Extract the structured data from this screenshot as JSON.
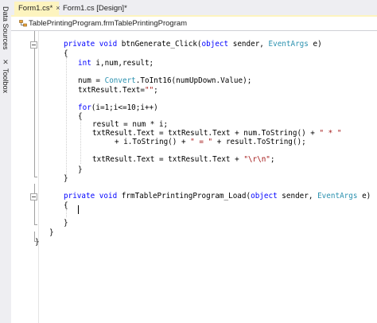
{
  "sidebar": {
    "data_sources_label": "Data Sources",
    "toolbox_label": "Toolbox"
  },
  "tabs": [
    {
      "label": "Form1.cs*",
      "active": true,
      "close": "×"
    },
    {
      "label": "Form1.cs [Design]*",
      "active": false
    }
  ],
  "navbar": {
    "path": "TablePrintingProgram.frmTablePrintingProgram"
  },
  "code": {
    "lines": [
      [
        [
          "kw",
          "private "
        ],
        [
          "kw",
          "void "
        ],
        [
          "tx",
          "btnGenerate_Click("
        ],
        [
          "kw",
          "object "
        ],
        [
          "tx",
          "sender, "
        ],
        [
          "ty",
          "EventArgs "
        ],
        [
          "tx",
          "e)"
        ]
      ],
      [
        [
          "tx",
          "{"
        ]
      ],
      [
        [
          "kw",
          "int "
        ],
        [
          "tx",
          "i,num,result;"
        ]
      ],
      [
        [
          "tx",
          ""
        ]
      ],
      [
        [
          "tx",
          "num = "
        ],
        [
          "ty",
          "Convert"
        ],
        [
          "tx",
          ".ToInt16(numUpDown.Value);"
        ]
      ],
      [
        [
          "tx",
          "txtResult.Text="
        ],
        [
          "st",
          "\"\""
        ],
        [
          "tx",
          ";"
        ]
      ],
      [
        [
          "tx",
          ""
        ]
      ],
      [
        [
          "kw",
          "for"
        ],
        [
          "tx",
          "(i=1;i<=10;i++)"
        ]
      ],
      [
        [
          "tx",
          "{"
        ]
      ],
      [
        [
          "tx",
          "result = num * i;"
        ]
      ],
      [
        [
          "tx",
          "txtResult.Text = txtResult.Text + num.ToString() + "
        ],
        [
          "st",
          "\" * \""
        ]
      ],
      [
        [
          "tx",
          "+ i.ToString() + "
        ],
        [
          "st",
          "\" = \""
        ],
        [
          "tx",
          " + result.ToString();"
        ]
      ],
      [
        [
          "tx",
          ""
        ]
      ],
      [
        [
          "tx",
          "txtResult.Text = txtResult.Text + "
        ],
        [
          "st",
          "\"\\r\\n\""
        ],
        [
          "tx",
          ";"
        ]
      ],
      [
        [
          "tx",
          "}"
        ]
      ],
      [
        [
          "tx",
          "}"
        ]
      ],
      [
        [
          "tx",
          ""
        ]
      ],
      [
        [
          "kw",
          "private "
        ],
        [
          "kw",
          "void "
        ],
        [
          "tx",
          "frmTablePrintingProgram_Load("
        ],
        [
          "kw",
          "object "
        ],
        [
          "tx",
          "sender, "
        ],
        [
          "ty",
          "EventArgs "
        ],
        [
          "tx",
          "e)"
        ]
      ],
      [
        [
          "tx",
          "{"
        ]
      ],
      [
        [
          "tx",
          ""
        ]
      ],
      [
        [
          "tx",
          "}"
        ]
      ],
      [
        [
          "tx",
          "}"
        ]
      ],
      [
        [
          "tx",
          "}"
        ]
      ]
    ]
  },
  "colors": {
    "keyword": "#0000ff",
    "type": "#2b91af",
    "string": "#a31515",
    "active_tab": "#fdf4bf"
  }
}
